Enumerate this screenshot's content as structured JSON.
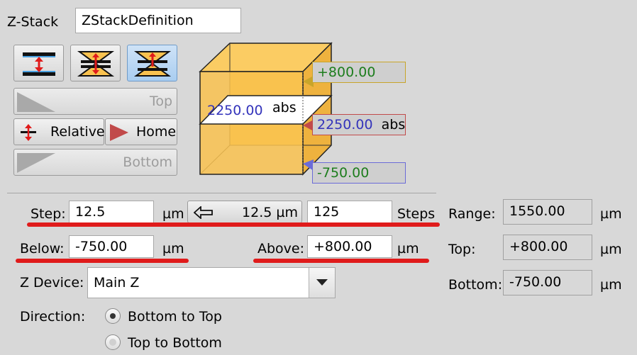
{
  "zstack": {
    "label": "Z-Stack",
    "name_value": "ZStackDefinition"
  },
  "buttons": {
    "top": "Top",
    "relative": "Relative",
    "home": "Home",
    "bottom": "Bottom",
    "step_arrow_value": "12.5 µm"
  },
  "diagram": {
    "top_value": "+800.00",
    "current_value": "2250.00",
    "current_unit": "abs",
    "bottom_value": "-750.00",
    "inside_value": "2250.00",
    "inside_unit": "abs"
  },
  "params": {
    "step_label": "Step:",
    "step_value": "12.5",
    "step_unit": "µm",
    "steps_value": "125",
    "steps_label": "Steps",
    "below_label": "Below:",
    "below_value": "-750.00",
    "below_unit": "µm",
    "above_label": "Above:",
    "above_value": "+800.00",
    "above_unit": "µm"
  },
  "summary": {
    "range_label": "Range:",
    "range_value": "1550.00",
    "range_unit": "µm",
    "top_label": "Top:",
    "top_value": "+800.00",
    "top_unit": "µm",
    "bottom_label": "Bottom:",
    "bottom_value": "-750.00",
    "bottom_unit": "µm"
  },
  "device": {
    "label": "Z Device:",
    "selected": "Main Z"
  },
  "direction": {
    "label": "Direction:",
    "options": [
      "Bottom to Top",
      "Top to Bottom"
    ],
    "selected": "Bottom to Top"
  },
  "colors": {
    "cube": "#f9c24f",
    "positive": "#1d7d1d",
    "current": "#3333bb",
    "highlight": "#e01b1b"
  }
}
